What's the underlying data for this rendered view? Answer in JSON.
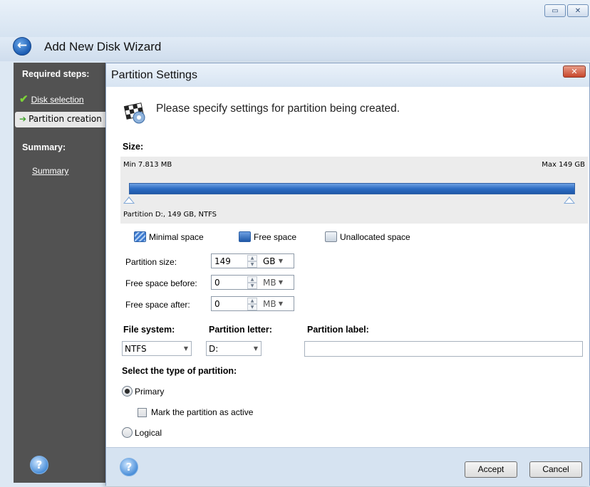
{
  "wizard": {
    "title": "Add New Disk Wizard",
    "window_buttons": [
      "restore-icon",
      "close-icon"
    ]
  },
  "sidebar": {
    "required_heading": "Required steps:",
    "steps": [
      {
        "label": "Disk selection",
        "status": "done"
      },
      {
        "label": "Partition creation",
        "status": "current"
      }
    ],
    "summary_heading": "Summary:",
    "summary_link": "Summary"
  },
  "dialog": {
    "title": "Partition Settings",
    "instruction": "Please specify settings for partition being created.",
    "size_label": "Size:",
    "size_panel": {
      "min": "Min 7.813 MB",
      "max": "Max 149 GB",
      "partition_info": "Partition D:, 149 GB, NTFS",
      "fill_fraction": 1.0
    },
    "legend": {
      "minimal": "Minimal space",
      "free": "Free space",
      "unallocated": "Unallocated space"
    },
    "fields": {
      "partition_size": {
        "label": "Partition size:",
        "value": "149",
        "unit": "GB"
      },
      "free_before": {
        "label": "Free space before:",
        "value": "0",
        "unit": "MB"
      },
      "free_after": {
        "label": "Free space after:",
        "value": "0",
        "unit": "MB"
      }
    },
    "file_system": {
      "label": "File system:",
      "value": "NTFS"
    },
    "partition_letter": {
      "label": "Partition letter:",
      "value": "D:"
    },
    "partition_label": {
      "label": "Partition label:",
      "value": ""
    },
    "partition_type": {
      "label": "Select the type of partition:",
      "primary": "Primary",
      "mark_active": "Mark the partition as active",
      "logical": "Logical",
      "selected": "primary"
    },
    "buttons": {
      "accept": "Accept",
      "cancel": "Cancel"
    }
  },
  "colors": {
    "sidebar_bg": "#525252",
    "bar_blue": "#2d6cc3",
    "footer_bg": "#d6e3f1",
    "close_red": "#c8462b"
  }
}
